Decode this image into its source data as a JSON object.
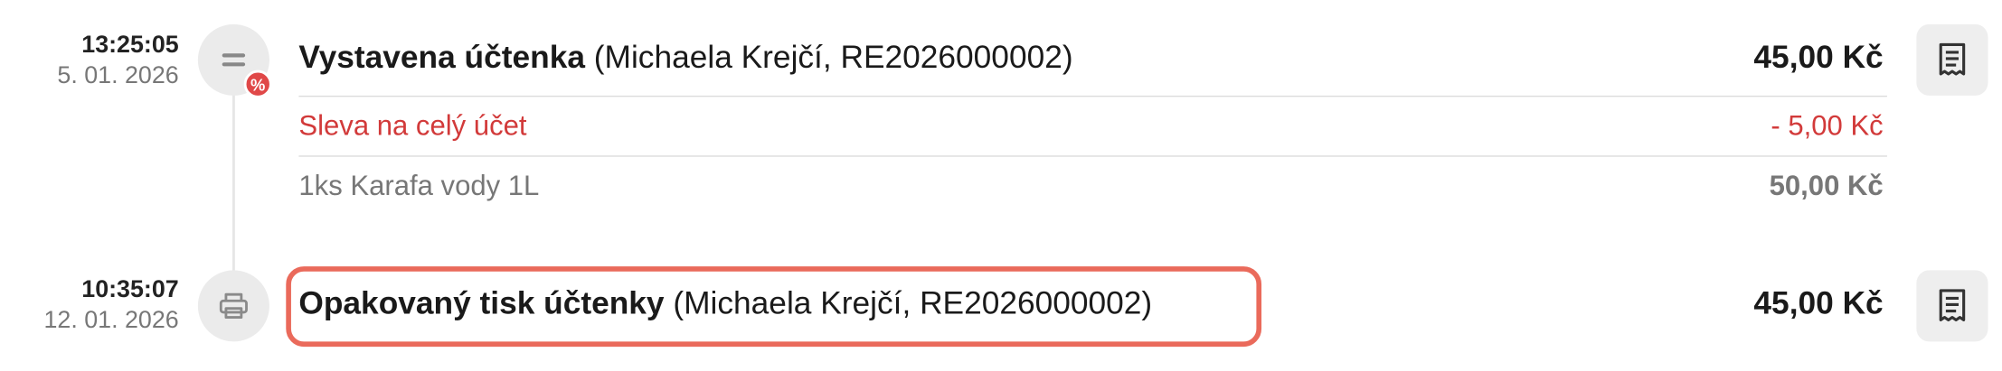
{
  "events": [
    {
      "time": "13:25:05",
      "date": "5. 01. 2026",
      "icon": "discount-icon",
      "badge": "%",
      "title_bold": "Vystavena účtenka",
      "title_detail": "(Michaela Krejčí, RE2026000002)",
      "amount": "45,00 Kč",
      "lines": [
        {
          "label": "Sleva na celý účet",
          "amount": "- 5,00 Kč",
          "style": "discount"
        },
        {
          "label": "1ks Karafa vody 1L",
          "amount": "50,00 Kč",
          "style": "item"
        }
      ]
    },
    {
      "time": "10:35:07",
      "date": "12. 01. 2026",
      "icon": "printer-icon",
      "title_bold": "Opakovaný tisk účtenky",
      "title_detail": "(Michaela Krejčí, RE2026000002)",
      "amount": "45,00 Kč"
    }
  ],
  "colors": {
    "discount": "#d23a3a",
    "highlight": "#ea6a5b",
    "badge": "#e04848"
  }
}
